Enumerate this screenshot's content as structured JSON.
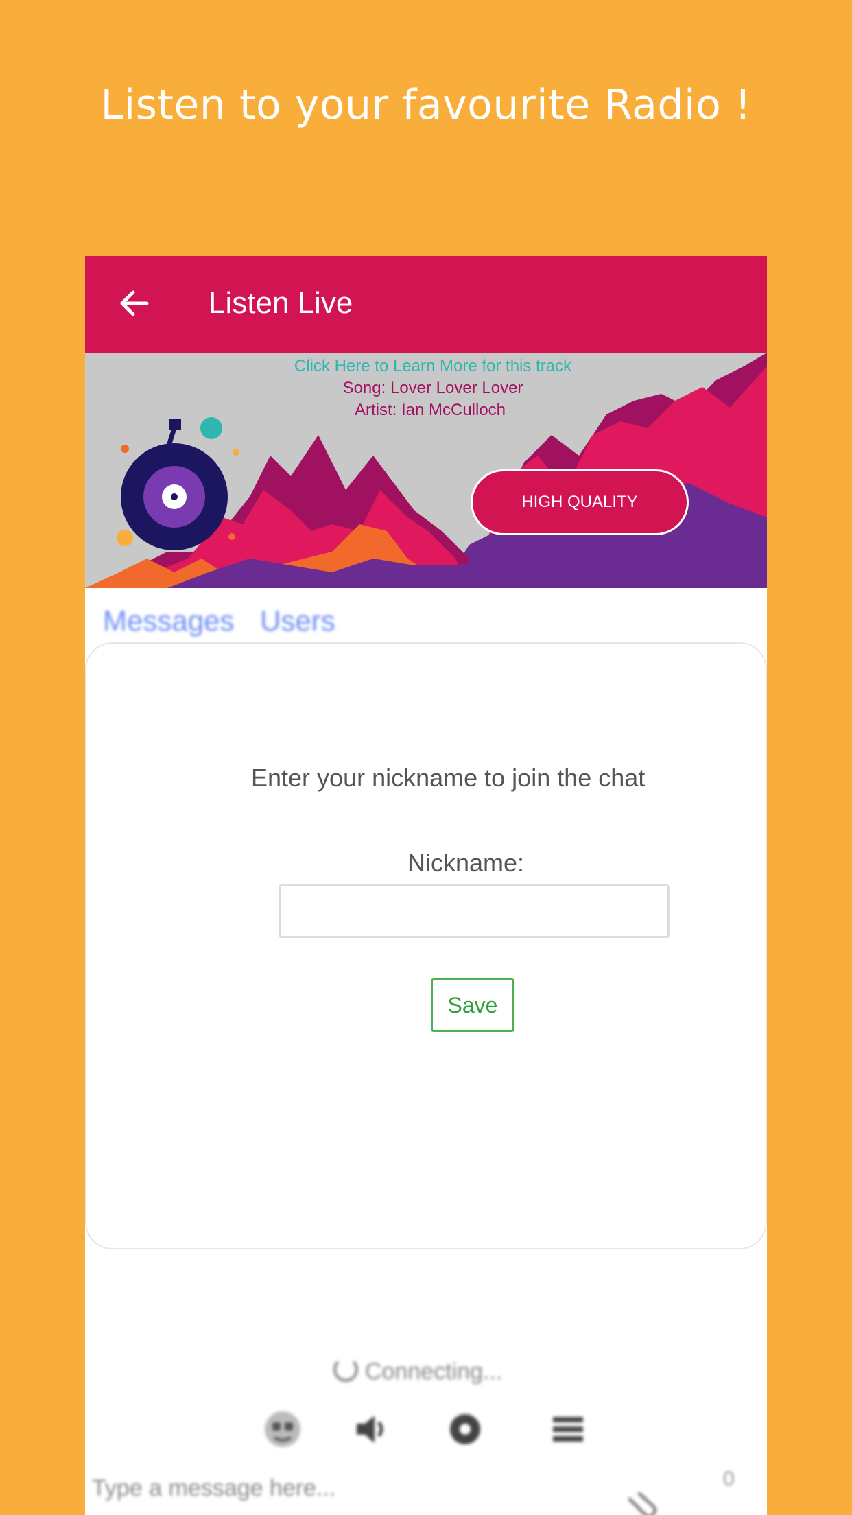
{
  "promo": {
    "title": "Listen to your favourite Radio !"
  },
  "colors": {
    "background": "#F9AD3B",
    "appbar": "#D31453",
    "accent_green": "#4CAF50",
    "tab_blue": "#6E8FF5",
    "track_link": "#2EB7B0"
  },
  "appbar": {
    "back_icon": "back-arrow-icon",
    "title": "Listen Live"
  },
  "banner": {
    "track_link": "Click Here to Learn More for this track",
    "song": "Song: Lover Lover Lover",
    "artist": "Artist: Ian McCulloch",
    "quality_button": "HIGH QUALITY"
  },
  "tabs": [
    {
      "label": "Messages"
    },
    {
      "label": "Users"
    }
  ],
  "chat": {
    "prompt": "Enter your nickname to join the chat",
    "nickname_label": "Nickname:",
    "nickname_value": "",
    "save_label": "Save"
  },
  "status": {
    "connecting": "Connecting..."
  },
  "toolbar": {
    "icons": [
      "emoji-icon",
      "volume-icon",
      "settings-icon",
      "menu-icon"
    ]
  },
  "composer": {
    "placeholder": "Type a message here...",
    "char_count": "0",
    "attach_icon": "attachment-icon"
  }
}
